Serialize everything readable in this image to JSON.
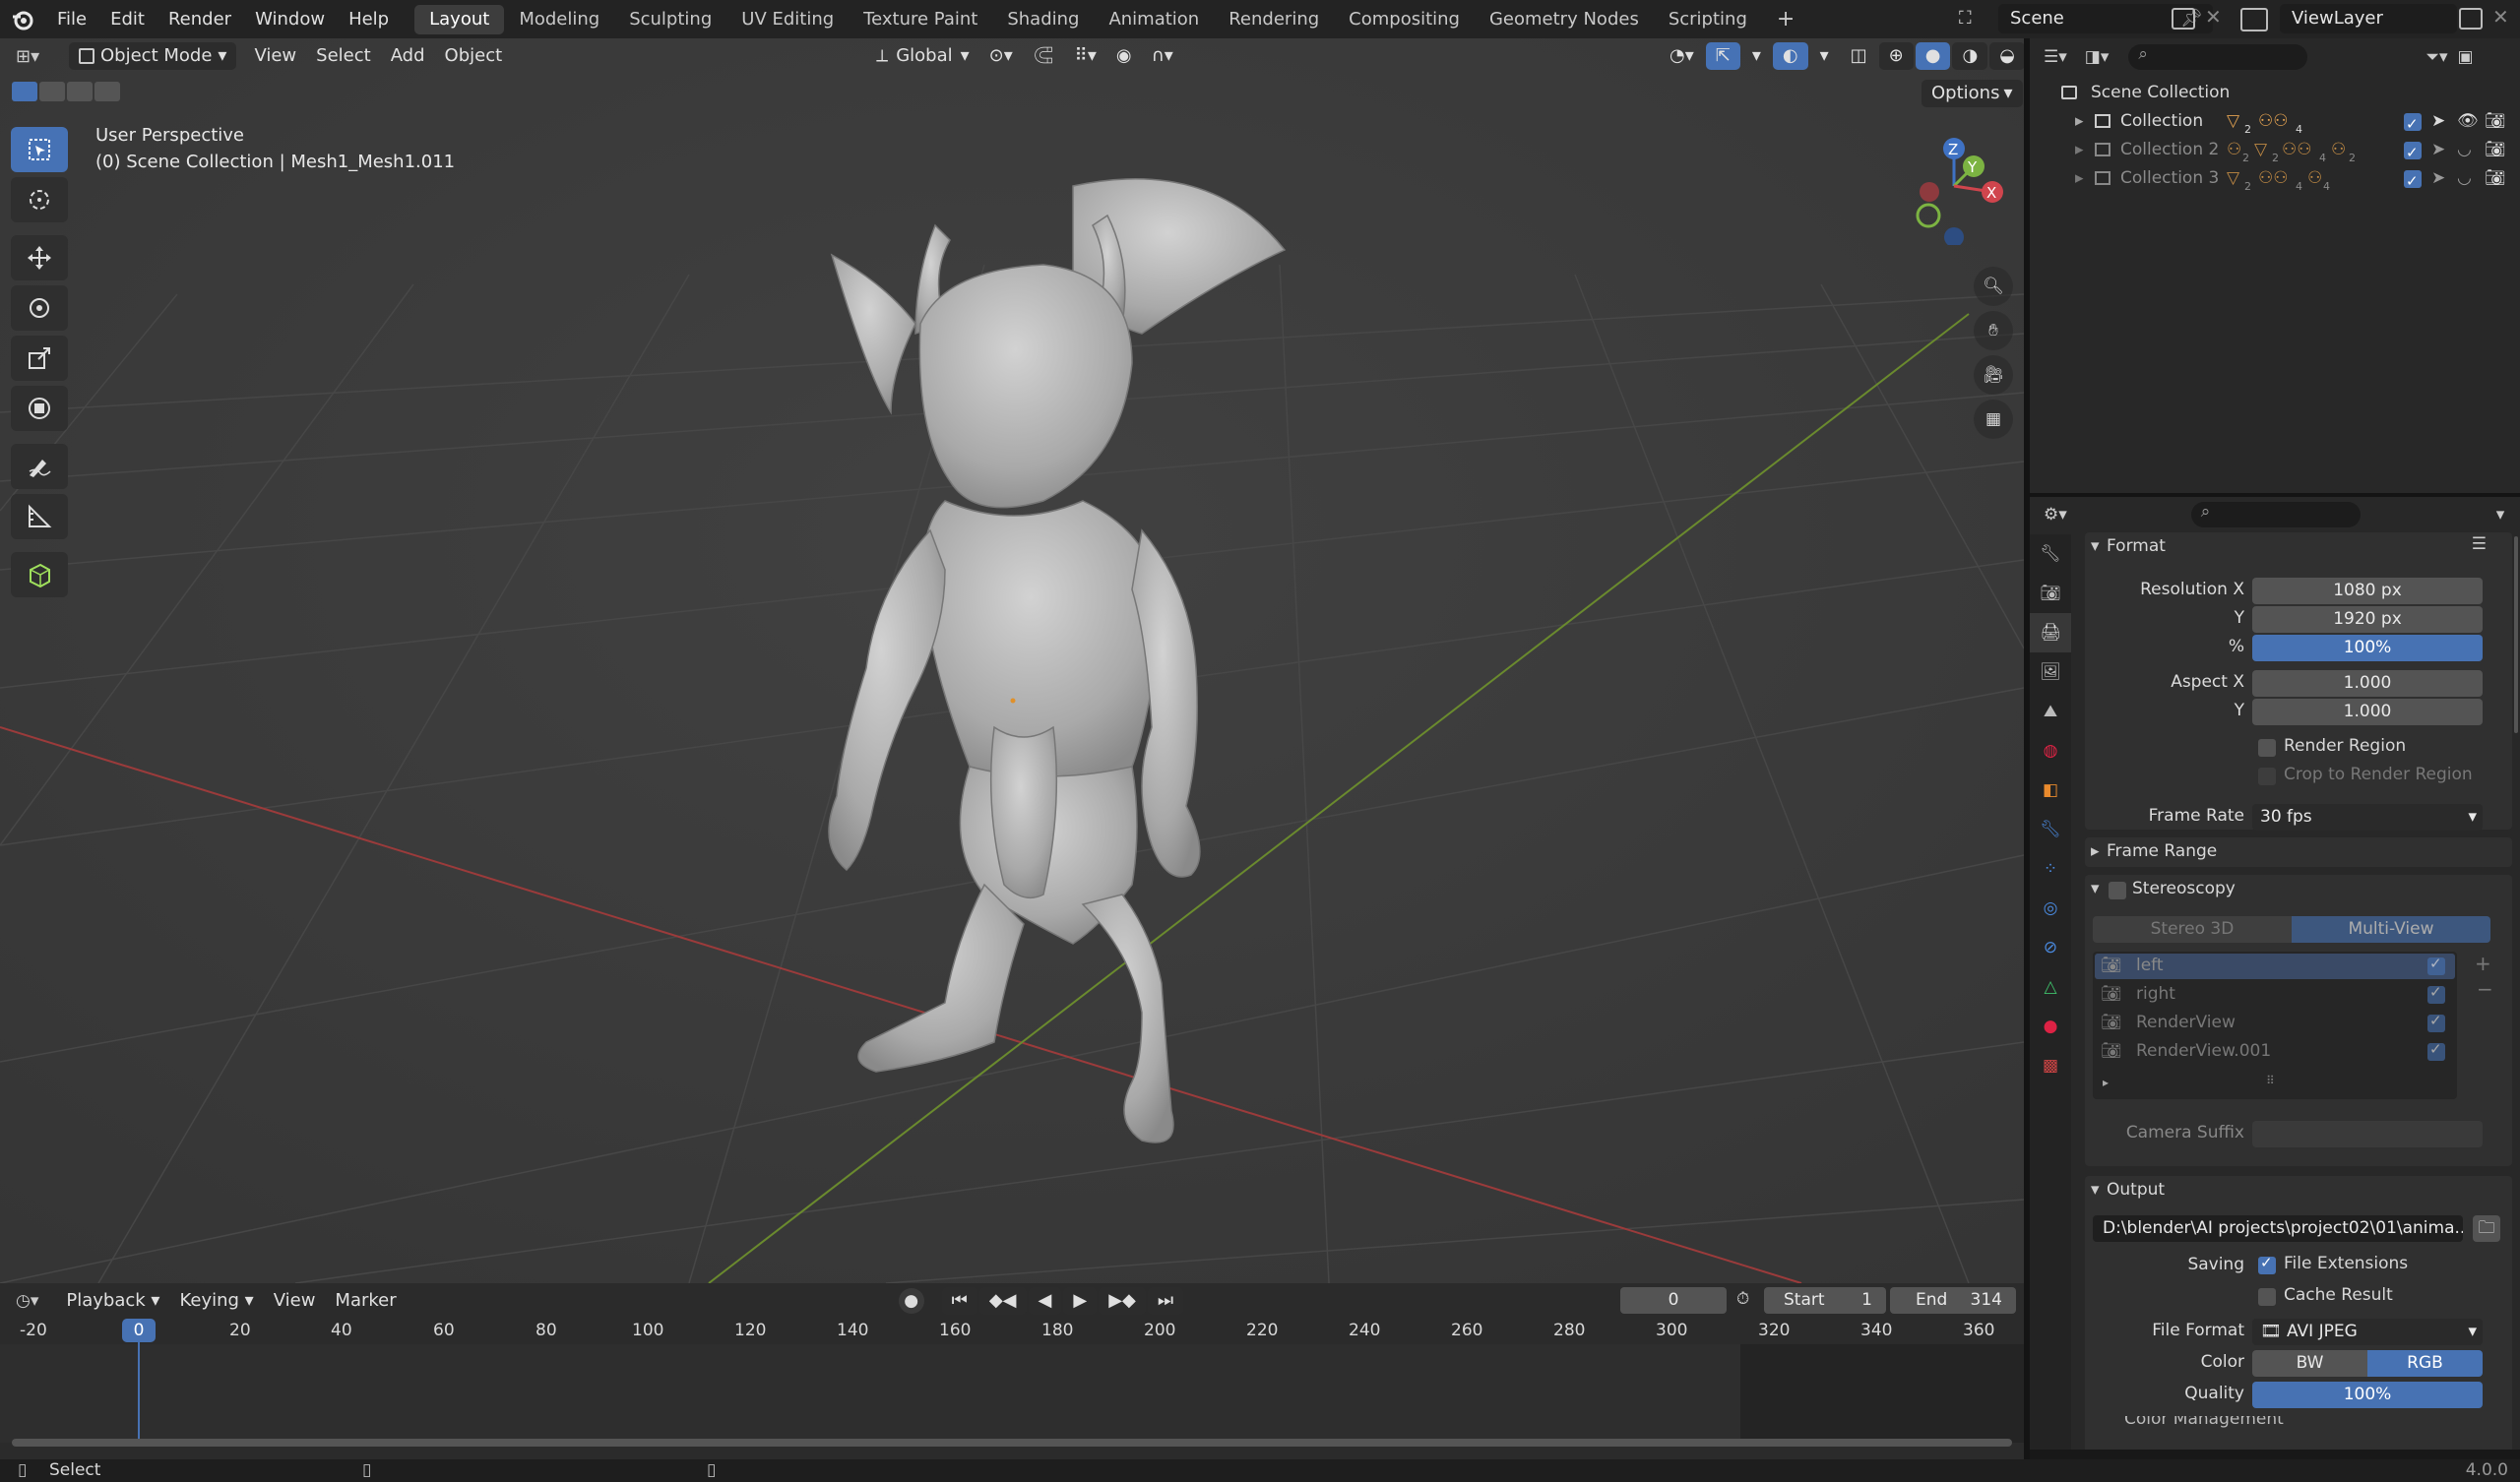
{
  "app": {
    "logo": "blender-logo-icon"
  },
  "menu": [
    "File",
    "Edit",
    "Render",
    "Window",
    "Help"
  ],
  "workspaces": [
    "Layout",
    "Modeling",
    "Sculpting",
    "UV Editing",
    "Texture Paint",
    "Shading",
    "Animation",
    "Rendering",
    "Compositing",
    "Geometry Nodes",
    "Scripting"
  ],
  "active_workspace": "Layout",
  "scene": {
    "name": "Scene",
    "view_layer": "ViewLayer"
  },
  "viewport": {
    "mode": "Object Mode",
    "menus": [
      "View",
      "Select",
      "Add",
      "Object"
    ],
    "orientation": "Global",
    "options": "Options",
    "view_name": "User Perspective",
    "collection_info": "(0) Scene Collection | Mesh1_Mesh1.011",
    "axis_labels": {
      "x": "X",
      "y": "Y",
      "z": "Z"
    }
  },
  "outliner": {
    "root": "Scene Collection",
    "collections": [
      {
        "name": "Collection",
        "badges": [
          "2",
          "4"
        ]
      },
      {
        "name": "Collection 2",
        "badges": [
          "2",
          "2",
          "4",
          "2"
        ]
      },
      {
        "name": "Collection 3",
        "badges": [
          "2",
          "4",
          "4"
        ]
      }
    ]
  },
  "properties": {
    "format": {
      "title": "Format",
      "resolution_x_label": "Resolution X",
      "resolution_x": "1080 px",
      "y_label": "Y",
      "resolution_y": "1920 px",
      "percent_label": "%",
      "percent": "100%",
      "aspect_x_label": "Aspect X",
      "aspect_x": "1.000",
      "aspect_y_label": "Y",
      "aspect_y": "1.000",
      "render_region": "Render Region",
      "crop_region": "Crop to Render Region",
      "frame_rate_label": "Frame Rate",
      "frame_rate": "30 fps"
    },
    "frame_range": {
      "title": "Frame Range"
    },
    "stereoscopy": {
      "title": "Stereoscopy",
      "tabs": [
        "Stereo 3D",
        "Multi-View"
      ],
      "active_tab": "Multi-View",
      "views": [
        "left",
        "right",
        "RenderView",
        "RenderView.001"
      ],
      "camera_suffix_label": "Camera Suffix"
    },
    "output": {
      "title": "Output",
      "path": "D:\\blender\\AI projects\\project02\\01\\anima...",
      "saving_label": "Saving",
      "file_extensions": "File Extensions",
      "cache_result": "Cache Result",
      "file_format_label": "File Format",
      "file_format": "AVI JPEG",
      "color_label": "Color",
      "color_options": [
        "BW",
        "RGB"
      ],
      "quality_label": "Quality",
      "quality": "100%",
      "next_section": "Color Management"
    }
  },
  "timeline": {
    "menus": [
      "Playback",
      "Keying",
      "View",
      "Marker"
    ],
    "current_frame": "0",
    "start_label": "Start",
    "start": "1",
    "end_label": "End",
    "end": "314",
    "ruler": [
      "-20",
      "0",
      "20",
      "40",
      "60",
      "80",
      "100",
      "120",
      "140",
      "160",
      "180",
      "200",
      "220",
      "240",
      "260",
      "280",
      "300",
      "320",
      "340",
      "360"
    ]
  },
  "status": {
    "left": "Select",
    "version": "4.0.0"
  }
}
